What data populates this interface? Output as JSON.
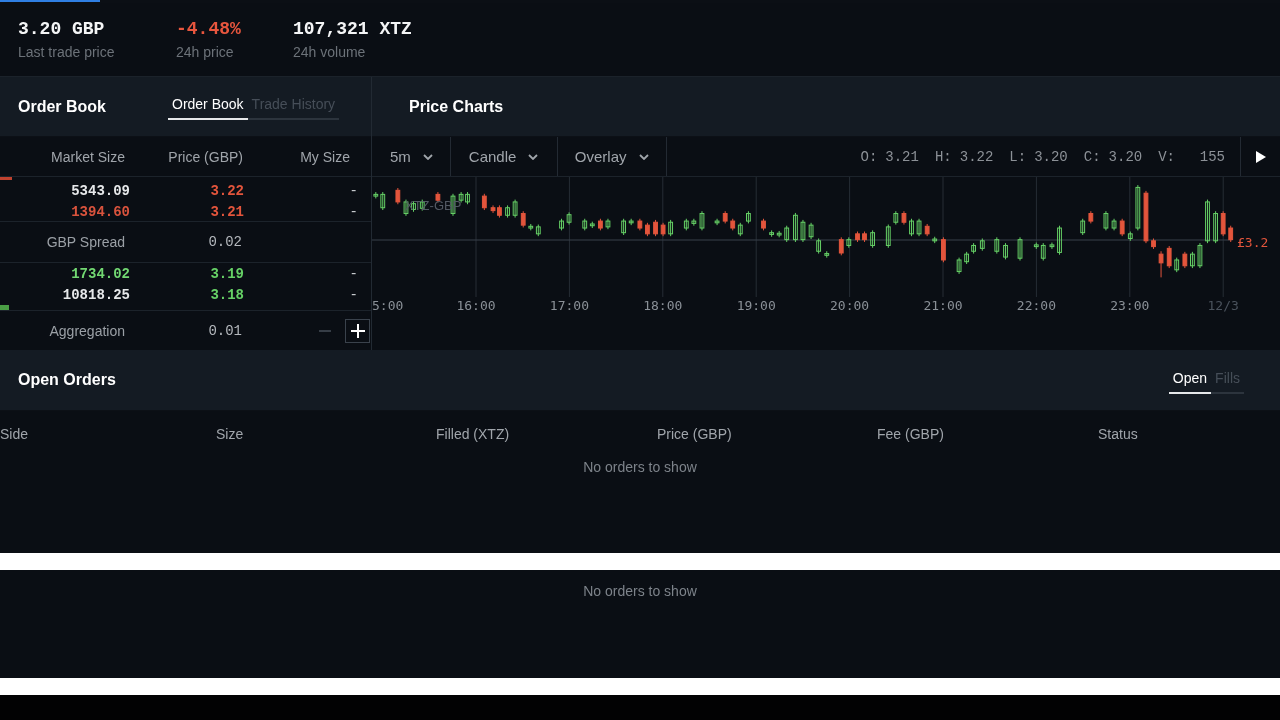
{
  "stats": [
    {
      "value": "3.20 GBP",
      "label": "Last trade price",
      "negative": false
    },
    {
      "value": "-4.48%",
      "label": "24h price",
      "negative": true
    },
    {
      "value": "107,321 XTZ",
      "label": "24h volume",
      "negative": false
    }
  ],
  "order_book": {
    "title": "Order Book",
    "tabs": [
      {
        "label": "Order Book",
        "selected": true
      },
      {
        "label": "Trade History",
        "selected": false
      }
    ],
    "columns": [
      "Market Size",
      "Price (GBP)",
      "My Size"
    ],
    "asks": [
      {
        "size": "5343.09",
        "price": "3.22",
        "my_size": "-",
        "updated": false
      },
      {
        "size": "1394.60",
        "price": "3.21",
        "my_size": "-",
        "updated": true
      }
    ],
    "spread": {
      "label": "GBP Spread",
      "value": "0.02"
    },
    "bids": [
      {
        "size": "1734.02",
        "price": "3.19",
        "my_size": "-",
        "updated": true
      },
      {
        "size": "10818.25",
        "price": "3.18",
        "my_size": "-",
        "updated": false
      }
    ],
    "aggregation": {
      "label": "Aggregation",
      "value": "0.01",
      "decrease_disabled": true,
      "increase_disabled": false
    }
  },
  "price_charts": {
    "title": "Price Charts",
    "toolbar": [
      "5m",
      "Candle",
      "Overlay"
    ],
    "ohlc": [
      {
        "label": "O:",
        "value": "3.21"
      },
      {
        "label": "H:",
        "value": "3.22"
      },
      {
        "label": "L:",
        "value": "3.20"
      },
      {
        "label": "C:",
        "value": "3.20"
      },
      {
        "label": "V:",
        "value": "155"
      }
    ],
    "chart": {
      "pair_label": "XTZ-GBP",
      "price_tag": "£3.2",
      "time_labels": [
        {
          "text": "5:00",
          "kind": "time"
        },
        {
          "text": "16:00",
          "kind": "time"
        },
        {
          "text": "17:00",
          "kind": "time"
        },
        {
          "text": "18:00",
          "kind": "time"
        },
        {
          "text": "19:00",
          "kind": "time"
        },
        {
          "text": "20:00",
          "kind": "time"
        },
        {
          "text": "21:00",
          "kind": "time"
        },
        {
          "text": "22:00",
          "kind": "time"
        },
        {
          "text": "23:00",
          "kind": "time"
        },
        {
          "text": "12/3",
          "kind": "date"
        }
      ]
    }
  },
  "open_orders": {
    "title": "Open Orders",
    "tabs": [
      {
        "label": "Open",
        "selected": true
      },
      {
        "label": "Fills",
        "selected": false
      }
    ],
    "columns": [
      "Side",
      "Size",
      "Filled (XTZ)",
      "Price (GBP)",
      "Fee (GBP)",
      "Status"
    ],
    "empty_message": "No orders to show"
  },
  "second_panel": {
    "empty_message": "No orders to show"
  }
}
